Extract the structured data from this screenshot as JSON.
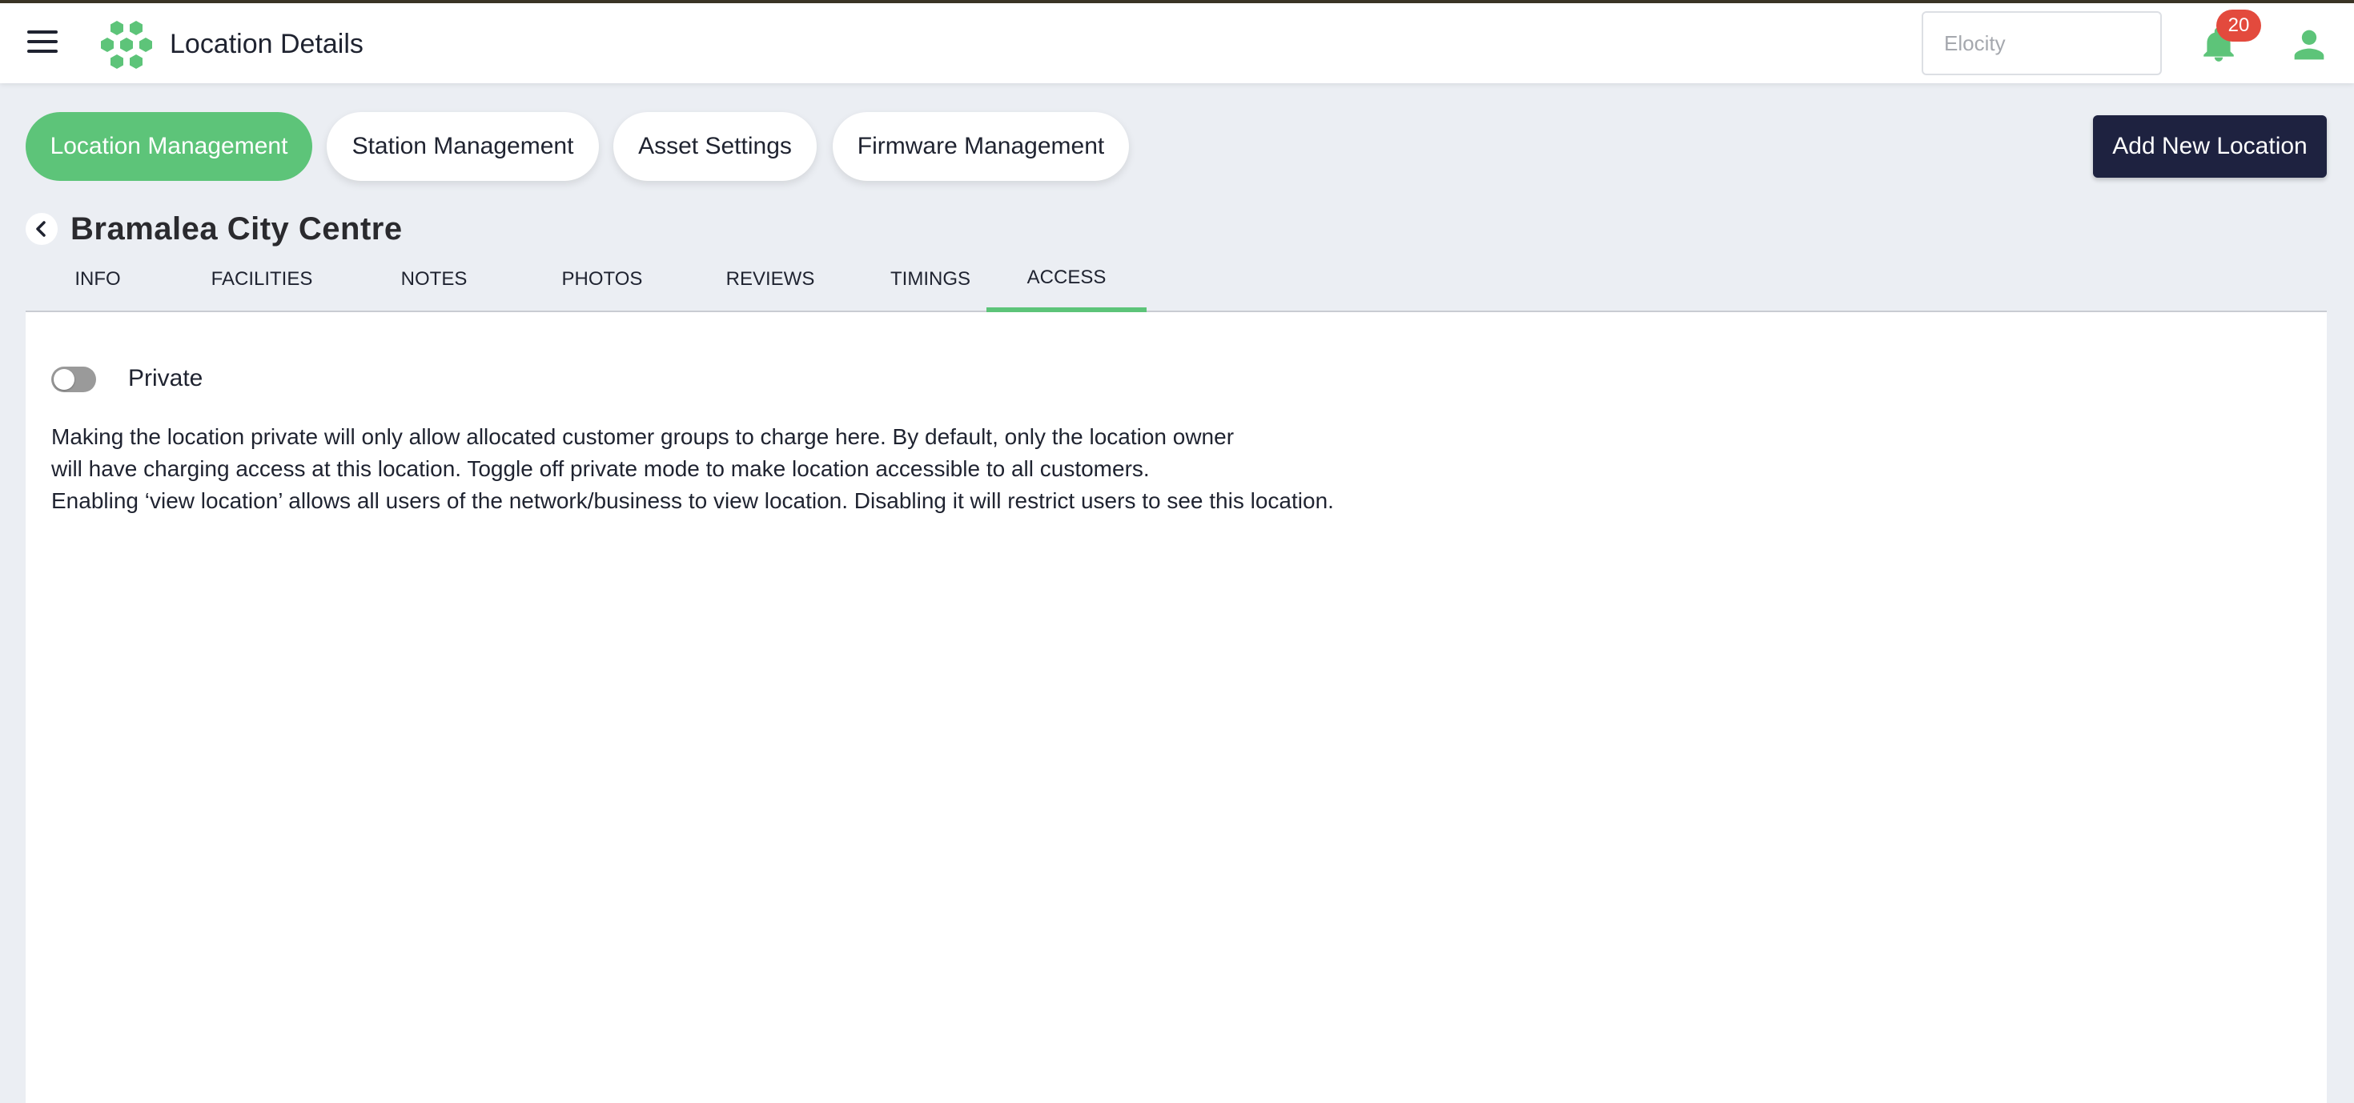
{
  "header": {
    "title": "Location Details",
    "search_placeholder": "Elocity",
    "notifications_count": "20",
    "icons": {
      "menu": "hamburger-icon",
      "logo": "hexagon-cluster-logo",
      "bell": "bell-icon",
      "user": "user-icon"
    }
  },
  "nav_pills": [
    {
      "label": "Location Management",
      "active": true
    },
    {
      "label": "Station Management",
      "active": false
    },
    {
      "label": "Asset Settings",
      "active": false
    },
    {
      "label": "Firmware Management",
      "active": false
    }
  ],
  "add_button": "Add New Location",
  "location": {
    "name": "Bramalea City Centre"
  },
  "tabs": [
    {
      "label": "INFO"
    },
    {
      "label": "FACILITIES"
    },
    {
      "label": "NOTES"
    },
    {
      "label": "PHOTOS"
    },
    {
      "label": "REVIEWS"
    },
    {
      "label": "TIMINGS"
    },
    {
      "label": "ACCESS",
      "active": true
    }
  ],
  "access": {
    "private_label": "Private",
    "private_enabled": false,
    "description_lines": [
      "Making the location private will only allow allocated customer groups to charge here. By default, only the location owner",
      "will have charging access at this location. Toggle off private mode to make location accessible to all customers.",
      "Enabling ‘view location’ allows all users of the network/business to view location. Disabling it will restrict users to see this location."
    ]
  },
  "colors": {
    "accent_green": "#5dc479",
    "primary_dark": "#1e2240",
    "badge_red": "#e34a3d",
    "background": "#ebeef3"
  }
}
